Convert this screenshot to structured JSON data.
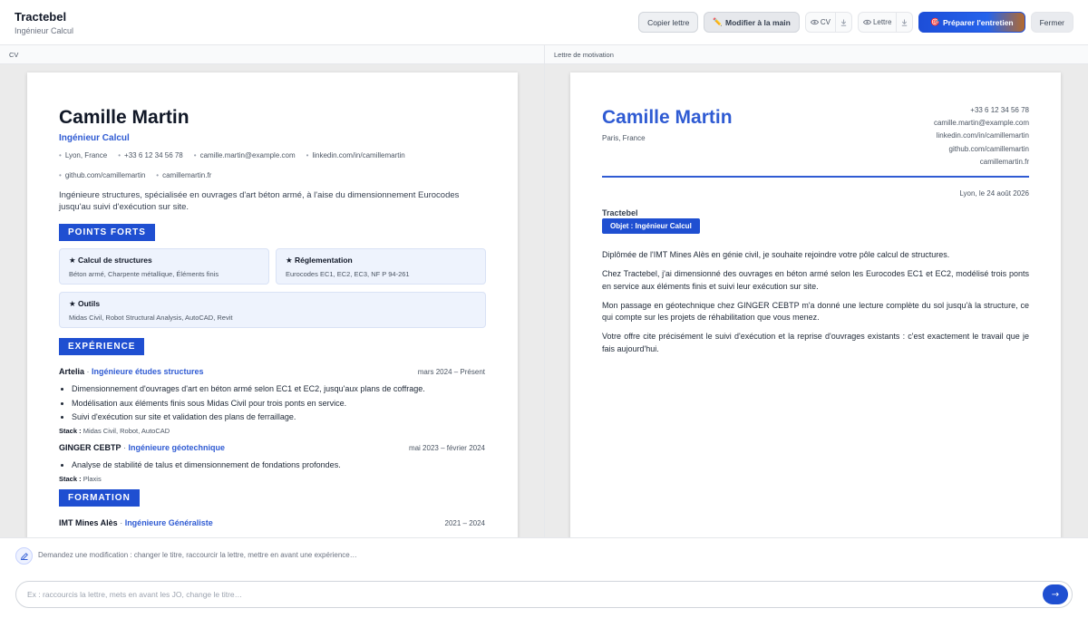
{
  "header": {
    "title": "Tractebel",
    "subtitle": "Ingénieur Calcul",
    "copy_label": "Copier lettre",
    "edit_icon": "✏️",
    "edit_label": "Modifier à la main",
    "cv_label": "CV",
    "letter_label": "Lettre",
    "prepare_icon": "🎯",
    "prepare_label": "Préparer l'entretien",
    "close_label": "Fermer"
  },
  "panes": {
    "cv_title": "CV",
    "letter_title": "Lettre de motivation"
  },
  "cv": {
    "name": "Camille Martin",
    "role": "Ingénieur Calcul",
    "contacts": [
      "Lyon, France",
      "+33 6 12 34 56 78",
      "camille.martin@example.com",
      "linkedin.com/in/camillemartin",
      "github.com/camillemartin",
      "camillemartin.fr"
    ],
    "summary": "Ingénieure structures, spécialisée en ouvrages d'art béton armé, à l'aise du dimensionnement Eurocodes jusqu'au suivi d'exécution sur site.",
    "strengths_title": "POINTS FORTS",
    "strengths": [
      {
        "title": "Calcul de structures",
        "desc": "Béton armé, Charpente métallique, Éléments finis"
      },
      {
        "title": "Réglementation",
        "desc": "Eurocodes EC1, EC2, EC3, NF P 94-261"
      },
      {
        "title": "Outils",
        "desc": "Midas Civil, Robot Structural Analysis, AutoCAD, Revit"
      }
    ],
    "experience_title": "EXPÉRIENCE",
    "stack_label": "Stack :",
    "jobs": [
      {
        "company": "Artelia",
        "title": "Ingénieure études structures",
        "dates": "mars 2024 – Présent",
        "bullets": [
          "Dimensionnement d'ouvrages d'art en béton armé selon EC1 et EC2, jusqu'aux plans de coffrage.",
          "Modélisation aux éléments finis sous Midas Civil pour trois ponts en service.",
          "Suivi d'exécution sur site et validation des plans de ferraillage."
        ],
        "stack": "Midas Civil, Robot, AutoCAD"
      },
      {
        "company": "GINGER CEBTP",
        "title": "Ingénieure géotechnique",
        "dates": "mai 2023 – février 2024",
        "bullets": [
          "Analyse de stabilité de talus et dimensionnement de fondations profondes."
        ],
        "stack": "Plaxis"
      }
    ],
    "education_title": "FORMATION",
    "education": [
      {
        "school": "IMT Mines Alès",
        "degree": "Ingénieure Généraliste",
        "dates": "2021 – 2024"
      }
    ]
  },
  "letter": {
    "name": "Camille Martin",
    "city": "Paris, France",
    "contacts": [
      "+33 6 12 34 56 78",
      "camille.martin@example.com",
      "linkedin.com/in/camillemartin",
      "github.com/camillemartin",
      "camillemartin.fr"
    ],
    "date": "Lyon, le 24 août 2026",
    "company": "Tractebel",
    "subject": "Objet : Ingénieur Calcul",
    "paragraphs": [
      "Diplômée de l'IMT Mines Alès en génie civil, je souhaite rejoindre votre pôle calcul de structures.",
      "Chez Tractebel, j'ai dimensionné des ouvrages en béton armé selon les Eurocodes EC1 et EC2, modélisé trois ponts en service aux éléments finis et suivi leur exécution sur site.",
      "Mon passage en géotechnique chez GINGER CEBTP m'a donné une lecture complète du sol jusqu'à la structure, ce qui compte sur les projets de réhabilitation que vous menez.",
      "Votre offre cite précisément le suivi d'exécution et la reprise d'ouvrages existants : c'est exactement le travail que je fais aujourd'hui."
    ]
  },
  "chat": {
    "hint": "Demandez une modification : changer le titre, raccourcir la lettre, mettre en avant une expérience…",
    "placeholder": "Ex : raccourcis la lettre, mets en avant les JO, change le titre…",
    "send_glyph": "→"
  },
  "icons": {
    "edit": "pencil-icon",
    "eye": "eye-icon",
    "download": "download-icon",
    "send": "arrow-right-icon",
    "chat": "edit-note-icon"
  },
  "colors": {
    "accent": "#1f4fd1",
    "link": "#2f5bd3"
  }
}
